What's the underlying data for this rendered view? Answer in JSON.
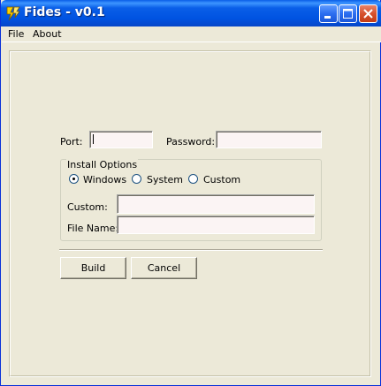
{
  "window": {
    "title": "Fides - v0.1"
  },
  "menu": {
    "file": "File",
    "about": "About"
  },
  "form": {
    "port_label": "Port:",
    "port_value": "",
    "password_label": "Password:",
    "password_value": "",
    "install_options": {
      "legend": "Install Options",
      "options": [
        "Windows",
        "System",
        "Custom"
      ],
      "selected": "Windows"
    },
    "custom_label": "Custom:",
    "custom_value": "",
    "filename_label": "File Name:",
    "filename_value": ""
  },
  "buttons": {
    "build": "Build",
    "cancel": "Cancel"
  },
  "icons": {
    "app": "lightning-app-icon",
    "minimize": "minimize-icon",
    "maximize": "maximize-icon",
    "close": "close-icon"
  },
  "colors": {
    "titlebar": "#0a5fe8",
    "window_bg": "#ece9d8",
    "field_bg": "#fbf4f4",
    "close_button": "#d6512d"
  }
}
